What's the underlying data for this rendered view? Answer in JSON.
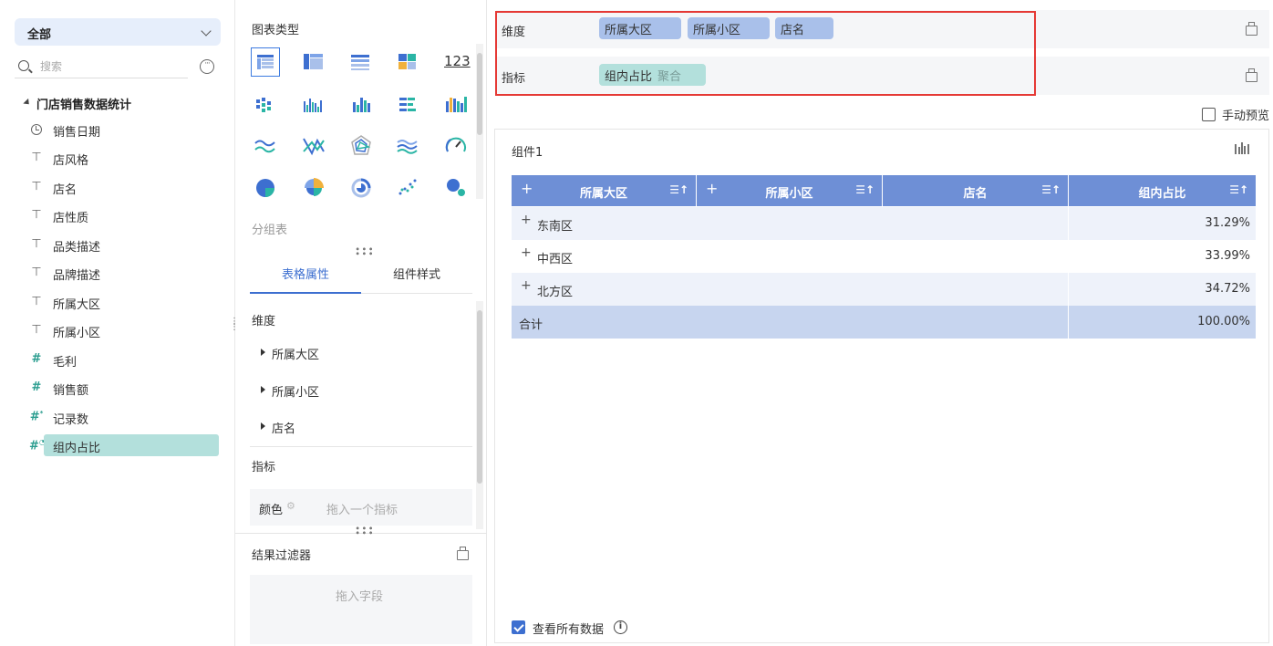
{
  "left": {
    "scope_label": "全部",
    "search_placeholder": "搜索",
    "tree_root": "门店销售数据统计",
    "fields": [
      {
        "label": "销售日期",
        "icon": "clock-icon"
      },
      {
        "label": "店风格",
        "icon": "text-field-icon"
      },
      {
        "label": "店名",
        "icon": "text-field-icon"
      },
      {
        "label": "店性质",
        "icon": "text-field-icon"
      },
      {
        "label": "品类描述",
        "icon": "text-field-icon"
      },
      {
        "label": "品牌描述",
        "icon": "text-field-icon"
      },
      {
        "label": "所属大区",
        "icon": "text-field-icon"
      },
      {
        "label": "所属小区",
        "icon": "text-field-icon"
      },
      {
        "label": "毛利",
        "icon": "number-field-icon"
      },
      {
        "label": "销售额",
        "icon": "number-field-icon"
      },
      {
        "label": "记录数",
        "icon": "count-field-icon"
      },
      {
        "label": "组内占比",
        "icon": "calc-field-icon"
      }
    ]
  },
  "middle": {
    "chart_type_title": "图表类型",
    "group_table_label": "分组表",
    "tabs": [
      "表格属性",
      "组件样式"
    ],
    "dimension_title": "维度",
    "dimension_items": [
      "所属大区",
      "所属小区",
      "店名"
    ],
    "measure_title": "指标",
    "color_label": "颜色",
    "color_placeholder": "拖入一个指标",
    "filter_title": "结果过滤器",
    "filter_placeholder": "拖入字段",
    "number_icon_text": "123"
  },
  "right": {
    "dimension_label": "维度",
    "dimension_pills": [
      "所属大区",
      "所属小区",
      "店名"
    ],
    "measure_label": "指标",
    "measure_pill": "组内占比",
    "measure_pill_sub": "聚合",
    "manual_preview": "手动预览",
    "component_title": "组件1",
    "view_all_label": "查看所有数据",
    "table": {
      "headers": [
        "所属大区",
        "所属小区",
        "店名",
        "组内占比"
      ],
      "rows": [
        {
          "region": "东南区",
          "ratio": "31.29%"
        },
        {
          "region": "中西区",
          "ratio": "33.99%"
        },
        {
          "region": "北方区",
          "ratio": "34.72%"
        }
      ],
      "total_label": "合计",
      "total_value": "100.00%"
    }
  },
  "colors": {
    "accent": "#3d6fd0",
    "header": "#6e8fd6",
    "dimension_pill": "#a9c0ea",
    "measure_pill": "#b3e0dc",
    "highlight": "#e53935"
  }
}
